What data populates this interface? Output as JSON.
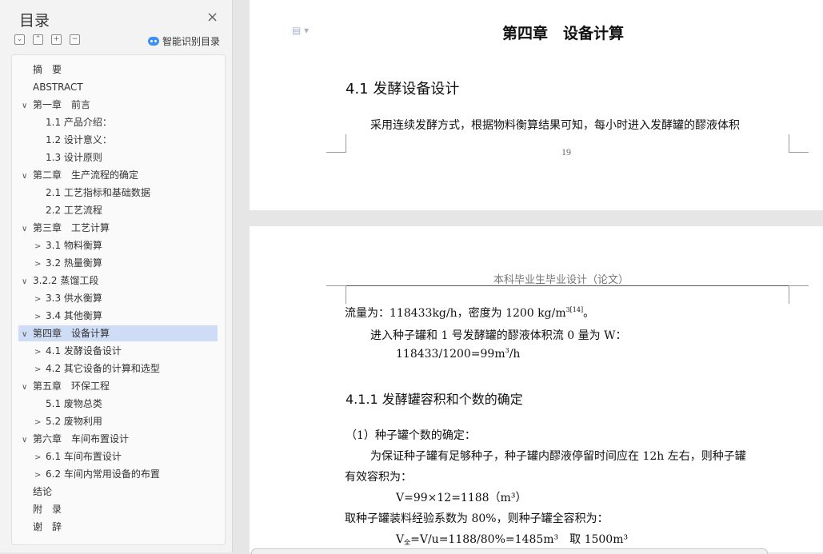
{
  "sidebar": {
    "title": "目录",
    "smart_label": "智能识别目录",
    "toc": [
      {
        "label": "摘　要",
        "level": 0,
        "arrow": ""
      },
      {
        "label": "ABSTRACT",
        "level": 0,
        "arrow": ""
      },
      {
        "label": "第一章　前言",
        "level": 0,
        "arrow": "∨"
      },
      {
        "label": "1.1 产品介绍：",
        "level": 1,
        "arrow": ""
      },
      {
        "label": "1.2 设计意义：",
        "level": 1,
        "arrow": ""
      },
      {
        "label": "1.3  设计原则",
        "level": 1,
        "arrow": ""
      },
      {
        "label": "第二章　生产流程的确定",
        "level": 0,
        "arrow": "∨"
      },
      {
        "label": "2.1  工艺指标和基础数据",
        "level": 1,
        "arrow": ""
      },
      {
        "label": "2.2  工艺流程",
        "level": 1,
        "arrow": ""
      },
      {
        "label": "第三章　工艺计算",
        "level": 0,
        "arrow": "∨"
      },
      {
        "label": "3.1 物料衡算",
        "level": 1,
        "arrow": ">"
      },
      {
        "label": "3.2  热量衡算",
        "level": 1,
        "arrow": ">"
      },
      {
        "label": "3.2.2  蒸馏工段",
        "level": 0,
        "arrow": "∨"
      },
      {
        "label": "3.3  供水衡算",
        "level": 1,
        "arrow": ">"
      },
      {
        "label": "3.4  其他衡算",
        "level": 1,
        "arrow": ">"
      },
      {
        "label": "第四章　设备计算",
        "level": 0,
        "arrow": "∨",
        "selected": true
      },
      {
        "label": "4.1 发酵设备设计",
        "level": 1,
        "arrow": ">"
      },
      {
        "label": "4.2 其它设备的计算和选型",
        "level": 1,
        "arrow": ">"
      },
      {
        "label": "第五章　环保工程",
        "level": 0,
        "arrow": "∨"
      },
      {
        "label": "5.1  废物总类",
        "level": 1,
        "arrow": ""
      },
      {
        "label": "5.2  废物利用",
        "level": 1,
        "arrow": ">"
      },
      {
        "label": "第六章　车间布置设计",
        "level": 0,
        "arrow": "∨"
      },
      {
        "label": "6.1 车间布置设计",
        "level": 1,
        "arrow": ">"
      },
      {
        "label": "6.2 车间内常用设备的布置",
        "level": 1,
        "arrow": ">"
      },
      {
        "label": "结论",
        "level": 0,
        "arrow": ""
      },
      {
        "label": "附　录",
        "level": 0,
        "arrow": ""
      },
      {
        "label": "谢　辞",
        "level": 0,
        "arrow": ""
      }
    ]
  },
  "page1": {
    "chapter": "第四章　设备计算",
    "section": "4.1 发酵设备设计",
    "para": "采用连续发酵方式，根据物料衡算结果可知，每小时进入发酵罐的醪液体积",
    "page_number": "19"
  },
  "page2": {
    "header": "本科毕业生毕业设计（论文）",
    "line1_a": "流量为：118433kg/h，密度为 1200 kg/m",
    "line1_sup": "3[14]",
    "line1_b": "。",
    "line2": "进入种子罐和 1 号发酵罐的醪液体积流 0 量为 W：",
    "line3_a": "118433/1200=99m",
    "line3_sup": "3",
    "line3_b": "/h",
    "subsection": "4.1.1 发酵罐容积和个数的确定",
    "item1": "（1）种子罐个数的确定：",
    "para2_a": "为保证种子罐有足够种子，种子罐内醪液停留时间应在 12h 左右，则种子罐",
    "para2_b": "有效容积为：",
    "formula1": "V=99×12=1188（m³）",
    "para3": "取种子罐装料经验系数为 80%，则种子罐全容积为：",
    "formula2_a": "V",
    "formula2_sub": "全",
    "formula2_b": "=V/u=1188/80%=1485m³　取 1500m³"
  }
}
